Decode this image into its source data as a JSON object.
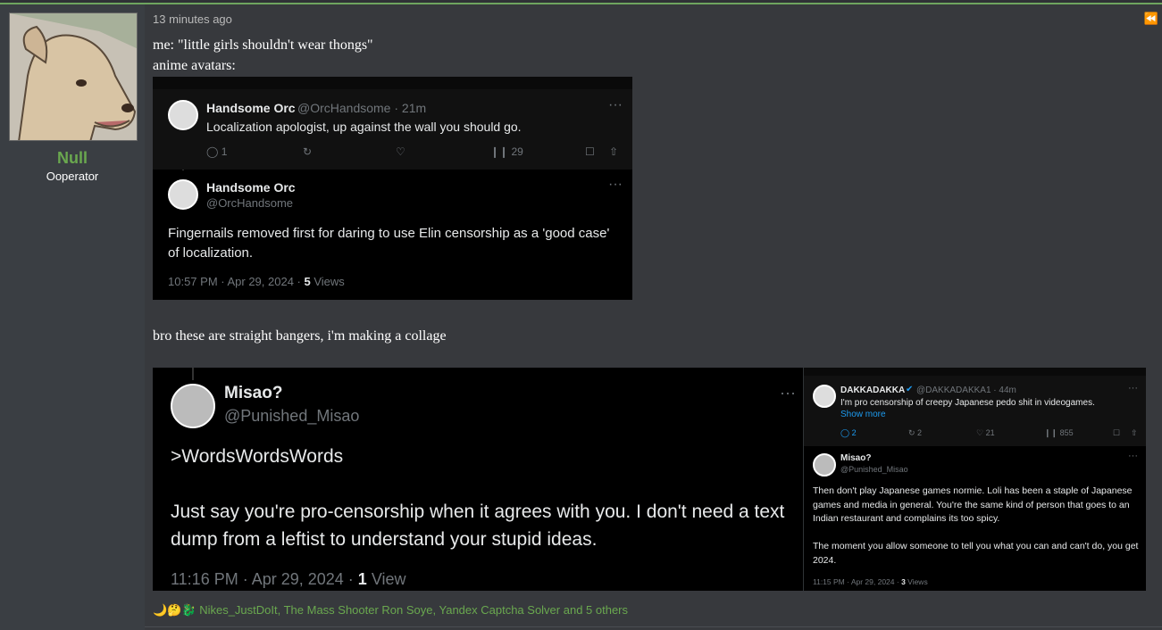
{
  "post": {
    "author": {
      "name": "Null",
      "title": "Ooperator"
    },
    "time": "13 minutes ago",
    "line1": "me: \"little girls shouldn't wear thongs\"",
    "line2": "anime avatars:",
    "line3": "bro these are straight bangers, i'm making a collage",
    "reactions": "Nikes_JustDoIt, The Mass Shooter Ron Soye, Yandex Captcha Solver and 5 others",
    "reaction_emojis": [
      "🌙",
      "🤔",
      "🐉"
    ]
  },
  "shot1": {
    "reply": {
      "name": "Handsome Orc",
      "handle": "@OrcHandsome · 21m",
      "text": "Localization apologist, up against the wall you should go.",
      "replies": "1",
      "views": "29"
    },
    "main": {
      "name": "Handsome Orc",
      "handle": "@OrcHandsome",
      "text": "Fingernails removed first for daring to use Elin censorship as a 'good case' of localization.",
      "meta": "10:57 PM · Apr 29, 2024 · ",
      "count": "5",
      "views_label": " Views"
    }
  },
  "shot2": {
    "left": {
      "name": "Misao?",
      "handle": "@Punished_Misao",
      "quote": ">WordsWordsWords",
      "text": "Just say you're pro-censorship when it agrees with you. I don't need a text dump from a leftist to understand your stupid ideas.",
      "meta": "11:16 PM · Apr 29, 2024 · ",
      "count": "1",
      "views_label": " View"
    },
    "right_reply": {
      "name": "DAKKADAKKA",
      "handle": "@DAKKADAKKA1 · 44m",
      "text": "I'm pro censorship of creepy Japanese pedo shit in videogames.",
      "show_more": "Show more",
      "replies": "2",
      "retweets": "2",
      "likes": "21",
      "views": "855"
    },
    "right_main": {
      "name": "Misao?",
      "handle": "@Punished_Misao",
      "para1": "Then don't play Japanese games normie. Loli has been a staple of Japanese games and media in general. You're the same kind of person that goes to an Indian restaurant and complains its too spicy.",
      "para2": "The moment you allow someone to tell you what you can and can't do, you get 2024.",
      "meta": "11:15 PM · Apr 29, 2024 · ",
      "count": "3",
      "views_label": " Views"
    }
  },
  "colors": {
    "accent": "#6aa84f",
    "tweet_bg": "#000000",
    "link": "#1d9bf0"
  }
}
